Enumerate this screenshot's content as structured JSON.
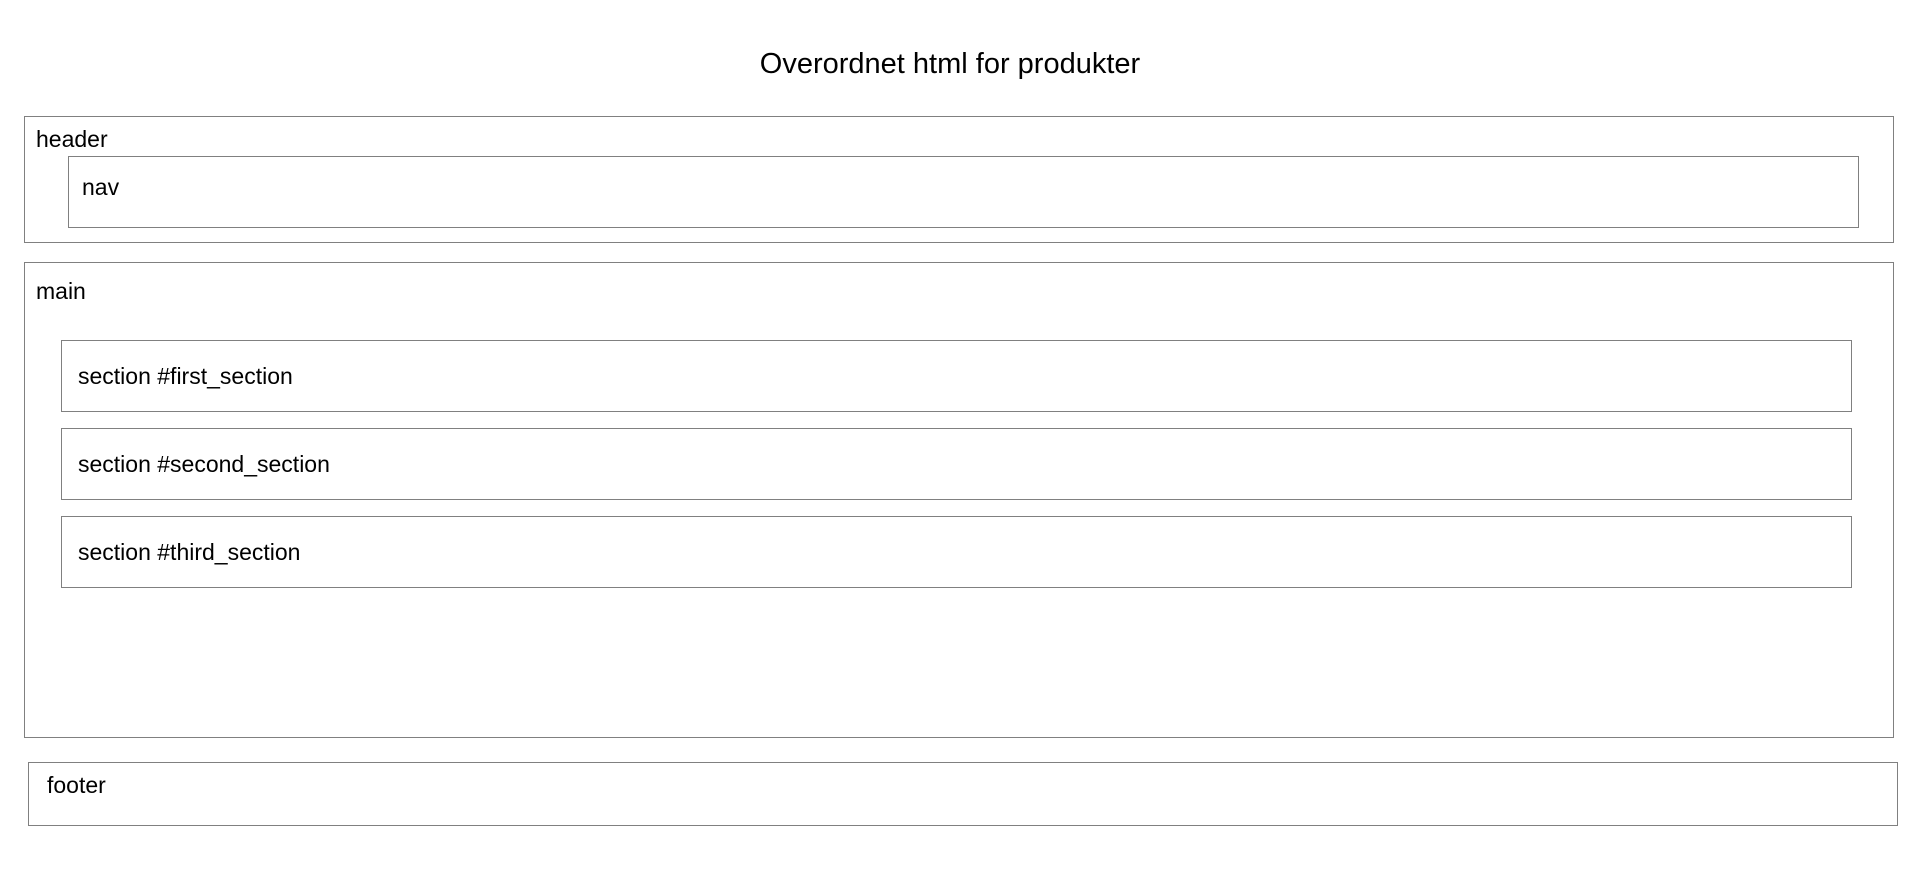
{
  "title": "Overordnet html for produkter",
  "header": {
    "label": "header",
    "nav": {
      "label": "nav"
    }
  },
  "main": {
    "label": "main",
    "sections": [
      {
        "label": "section #first_section"
      },
      {
        "label": "section #second_section"
      },
      {
        "label": "section #third_section"
      }
    ]
  },
  "footer": {
    "label": "footer"
  }
}
